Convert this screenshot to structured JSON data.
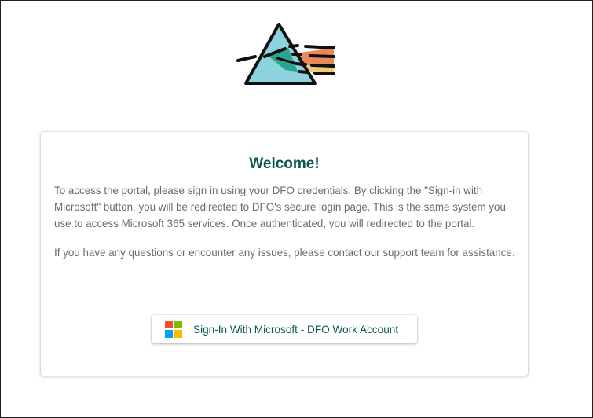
{
  "brand": {
    "logo_icon": "prism-icon",
    "colors": {
      "prism_fill": "#8dd3df",
      "beam_teal": "#2ba58f",
      "beam_orange": "#e8895a",
      "beam_yellow": "#f2c879",
      "outline": "#111111"
    }
  },
  "welcome": {
    "title": "Welcome!",
    "paragraph_1": "To access the portal, please sign in using your DFO credentials. By clicking the \"Sign-in with Microsoft\" button, you will be redirected to DFO's secure login page. This is the same system you use to access Microsoft 365 services. Once authenticated, you will redirected to the portal.",
    "paragraph_2": "If you have any questions or encounter any issues, please contact our support team for assistance."
  },
  "signin_button": {
    "label": "Sign-In With Microsoft - DFO Work Account",
    "icon": "microsoft-logo-icon",
    "logo_colors": [
      "#f25022",
      "#7fba00",
      "#00a4ef",
      "#ffb900"
    ]
  },
  "theme": {
    "title_color": "#0b5752",
    "text_color": "#6b6b6b"
  }
}
